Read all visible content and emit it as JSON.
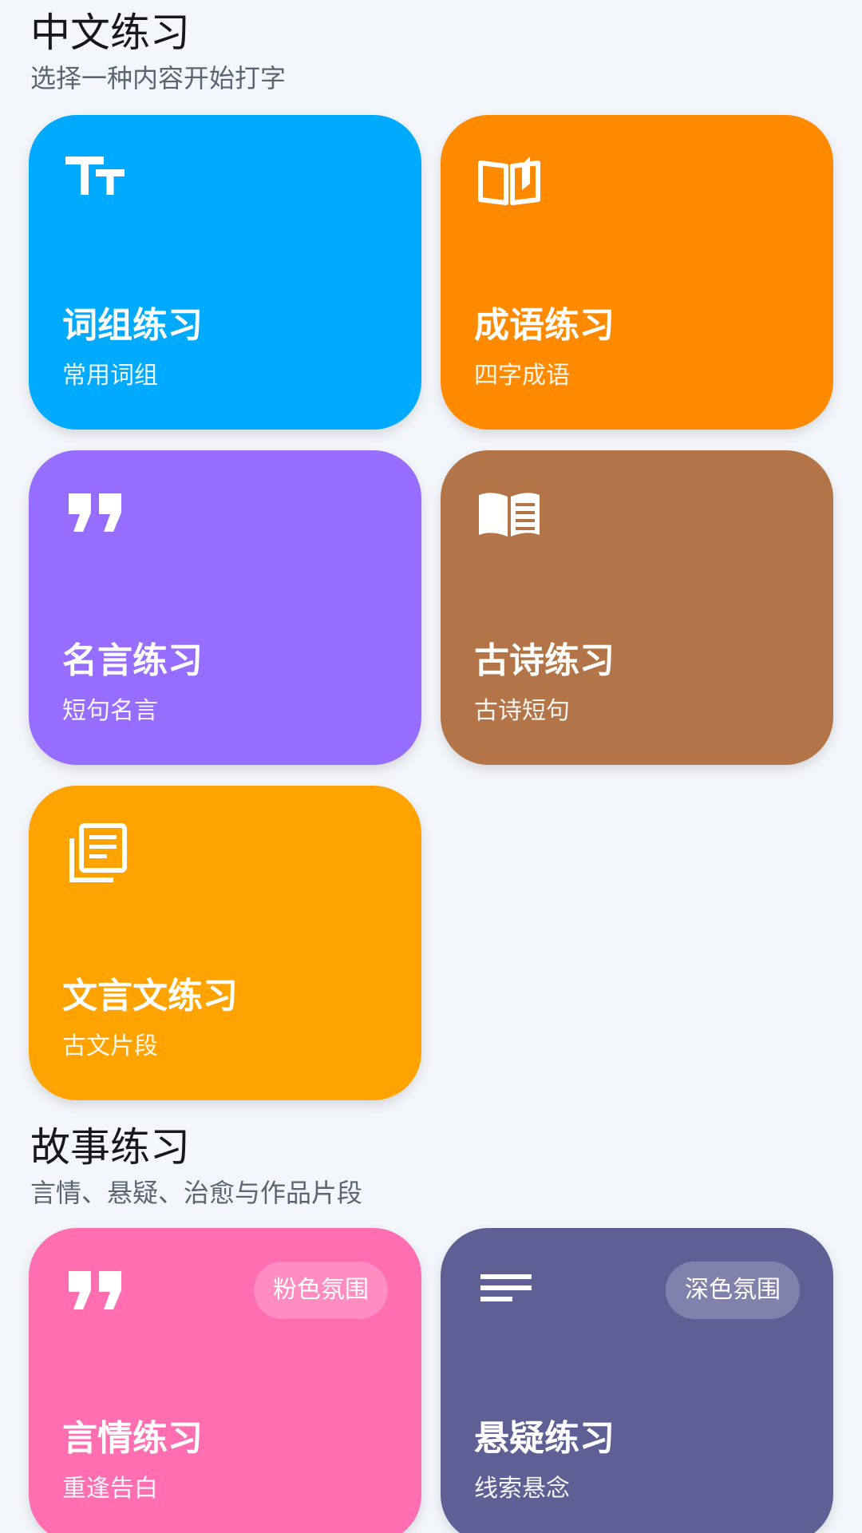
{
  "chinese_section": {
    "title": "中文练习",
    "subtitle": "选择一种内容开始打字",
    "cards": [
      {
        "title": "词组练习",
        "subtitle": "常用词组",
        "color": "#00aaff",
        "icon": "text-size-icon"
      },
      {
        "title": "成语练习",
        "subtitle": "四字成语",
        "color": "#ff8a00",
        "icon": "open-book-icon"
      },
      {
        "title": "名言练习",
        "subtitle": "短句名言",
        "color": "#976dff",
        "icon": "quote-icon"
      },
      {
        "title": "古诗练习",
        "subtitle": "古诗短句",
        "color": "#b37447",
        "icon": "reading-book-icon"
      },
      {
        "title": "文言文练习",
        "subtitle": "古文片段",
        "color": "#ffa300",
        "icon": "article-stack-icon"
      }
    ]
  },
  "story_section": {
    "title": "故事练习",
    "subtitle": "言情、悬疑、治愈与作品片段",
    "cards": [
      {
        "title": "言情练习",
        "subtitle": "重逢告白",
        "badge": "粉色氛围",
        "color": "#ff6eb0",
        "icon": "quote-icon"
      },
      {
        "title": "悬疑练习",
        "subtitle": "线索悬念",
        "badge": "深色氛围",
        "color": "#5e5f95",
        "icon": "text-lines-icon"
      }
    ]
  }
}
